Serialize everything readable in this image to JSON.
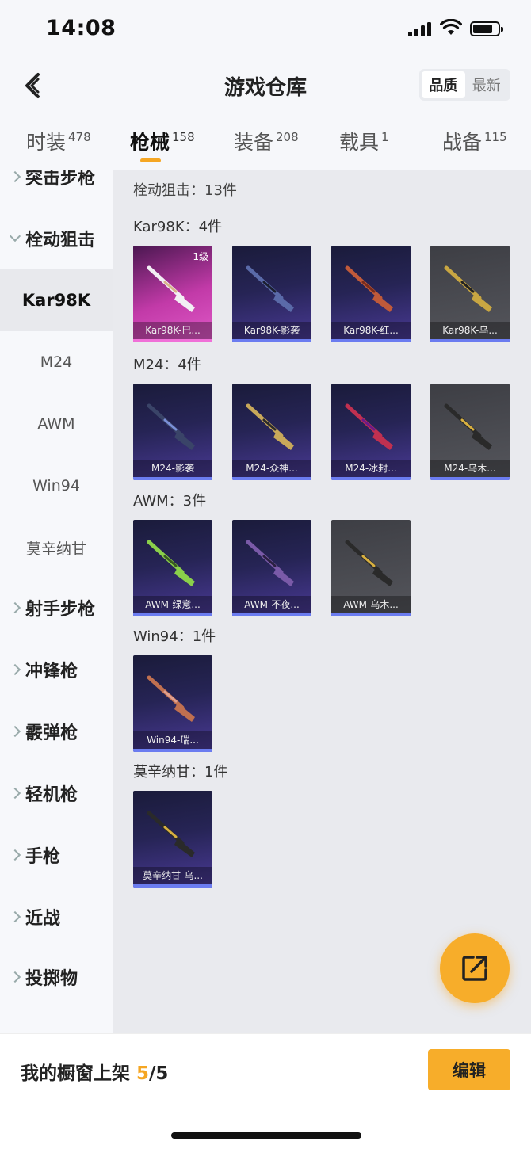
{
  "status_bar": {
    "time": "14:08"
  },
  "header": {
    "title": "游戏仓库",
    "sort_options": [
      "品质",
      "最新"
    ],
    "active_sort": "品质"
  },
  "tabs": [
    {
      "label": "时装",
      "count": "478"
    },
    {
      "label": "枪械",
      "count": "158"
    },
    {
      "label": "装备",
      "count": "208"
    },
    {
      "label": "载具",
      "count": "1"
    },
    {
      "label": "战备",
      "count": "115"
    }
  ],
  "sidebar": {
    "top_category": "突击步枪",
    "expanded_category": "栓动狙击",
    "subcategories": [
      "Kar98K",
      "M24",
      "AWM",
      "Win94",
      "莫辛纳甘"
    ],
    "active_subcategory": "Kar98K",
    "other_categories": [
      "射手步枪",
      "冲锋枪",
      "霰弹枪",
      "轻机枪",
      "手枪",
      "近战",
      "投掷物"
    ]
  },
  "content": {
    "summary": "栓动狙击：13件",
    "groups": [
      {
        "title": "Kar98K：4件",
        "items": [
          {
            "name": "Kar98K-巳...",
            "level": "1级",
            "rarity": "pink",
            "gun_color": "#f2eff4",
            "accent": "#d8b48a"
          },
          {
            "name": "Kar98K-影袭",
            "rarity": "purple",
            "gun_color": "#5a6aa8",
            "accent": "#1c2030"
          },
          {
            "name": "Kar98K-红...",
            "rarity": "purple",
            "gun_color": "#c05a3a",
            "accent": "#7a2c1c"
          },
          {
            "name": "Kar98K-乌...",
            "rarity": "grey",
            "gun_color": "#c8a642",
            "accent": "#222"
          }
        ]
      },
      {
        "title": "M24：4件",
        "items": [
          {
            "name": "M24-影袭",
            "rarity": "purple",
            "gun_color": "#3a4468",
            "accent": "#7b8fd8"
          },
          {
            "name": "M24-众神...",
            "rarity": "purple",
            "gun_color": "#c8a85a",
            "accent": "#2a2a2a"
          },
          {
            "name": "M24-冰封...",
            "rarity": "purple",
            "gun_color": "#c03050",
            "accent": "#6a1a8a"
          },
          {
            "name": "M24-乌木...",
            "rarity": "grey",
            "gun_color": "#2a2a2a",
            "accent": "#d8b040"
          }
        ]
      },
      {
        "title": "AWM：3件",
        "items": [
          {
            "name": "AWM-绿意...",
            "rarity": "purple",
            "gun_color": "#8ad04a",
            "accent": "#3a5a20"
          },
          {
            "name": "AWM-不夜...",
            "rarity": "purple",
            "gun_color": "#7a5aa8",
            "accent": "#2a2040"
          },
          {
            "name": "AWM-乌木...",
            "rarity": "grey",
            "gun_color": "#2a2a2a",
            "accent": "#d8b040"
          }
        ]
      },
      {
        "title": "Win94：1件",
        "items": [
          {
            "name": "Win94-瑞...",
            "rarity": "purple",
            "gun_color": "#c07050",
            "accent": "#e0a090"
          }
        ]
      },
      {
        "title": "莫辛纳甘：1件",
        "items": [
          {
            "name": "莫辛纳甘-乌...",
            "rarity": "purple",
            "gun_color": "#2a2a2a",
            "accent": "#d8b040"
          }
        ]
      }
    ]
  },
  "bottom_bar": {
    "label": "我的橱窗上架",
    "count": "5",
    "total": "/5",
    "edit_label": "编辑"
  },
  "colors": {
    "accent": "#f5a623",
    "purple_bar": "#6b7cf0",
    "pink": "#e05ac8"
  },
  "icons": [
    "back-chevron-icon",
    "signal-icon",
    "wifi-icon",
    "battery-icon",
    "share-icon"
  ]
}
